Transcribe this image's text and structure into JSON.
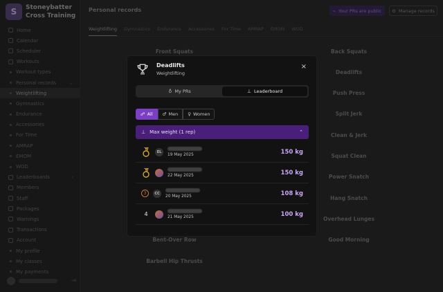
{
  "app": {
    "brand_name": "Stoneybatter Cross Training",
    "brand_initial": "S"
  },
  "sidebar": {
    "items": [
      {
        "label": "Home",
        "type": "item"
      },
      {
        "label": "Calendar",
        "type": "item"
      },
      {
        "label": "Scheduler",
        "type": "item"
      },
      {
        "label": "Workouts",
        "type": "item"
      },
      {
        "label": "Workout types",
        "type": "sub"
      },
      {
        "label": "Personal records",
        "type": "sub"
      },
      {
        "label": "Weightlifting",
        "type": "sub",
        "active": true
      },
      {
        "label": "Gymnastics",
        "type": "sub"
      },
      {
        "label": "Endurance",
        "type": "sub"
      },
      {
        "label": "Accessories",
        "type": "sub"
      },
      {
        "label": "For Time",
        "type": "sub"
      },
      {
        "label": "AMRAP",
        "type": "sub"
      },
      {
        "label": "EMOM",
        "type": "sub"
      },
      {
        "label": "WOD",
        "type": "sub"
      },
      {
        "label": "Leaderboards",
        "type": "item"
      },
      {
        "label": "Members",
        "type": "item"
      },
      {
        "label": "Staff",
        "type": "item"
      },
      {
        "label": "Packages",
        "type": "item"
      },
      {
        "label": "Warnings",
        "type": "item"
      },
      {
        "label": "Transactions",
        "type": "item"
      },
      {
        "label": "Account",
        "type": "item"
      },
      {
        "label": "My profile",
        "type": "sub"
      },
      {
        "label": "My classes",
        "type": "sub"
      },
      {
        "label": "My payments",
        "type": "sub"
      }
    ]
  },
  "header": {
    "title": "Personal records",
    "public_label": "Your PRs are public",
    "manage_label": "Manage records"
  },
  "tabs": [
    "Weightlifting",
    "Gymnastics",
    "Endurance",
    "Accessories",
    "For Time",
    "AMRAP",
    "EMOM",
    "WOD"
  ],
  "records": {
    "left": [
      "Front Squats",
      "",
      "",
      "",
      "",
      "",
      "",
      "",
      "",
      "Bent-Over Row",
      "Barbell Hip Thrusts"
    ],
    "right": [
      "Back Squats",
      "Deadlifts",
      "Push Press",
      "Split Jerk",
      "Clean & Jerk",
      "Squat Clean",
      "Power Snatch",
      "Hang Snatch",
      "Overhead Lunges",
      "Good Morning"
    ]
  },
  "modal": {
    "title": "Deadlifts",
    "subtitle": "Weightlifting",
    "close": "×",
    "seg_my_prs": "My PRs",
    "seg_leaderboard": "Leaderboard",
    "filter_all": "All",
    "filter_men": "Men",
    "filter_women": "Women",
    "section_title": "Max weight (1 rep)",
    "entries": [
      {
        "rank": "1",
        "initials": "EL",
        "date": "19 May 2025",
        "value": "150 kg",
        "medal": "gold"
      },
      {
        "rank": "1",
        "initials": "",
        "date": "22 May 2025",
        "value": "150 kg",
        "medal": "gold"
      },
      {
        "rank": "3",
        "initials": "CC",
        "date": "20 May 2025",
        "value": "108 kg",
        "medal": "bronze"
      },
      {
        "rank": "4",
        "initials": "",
        "date": "21 May 2025",
        "value": "100 kg",
        "medal": "none"
      }
    ]
  },
  "colors": {
    "accent": "#7a3fc4",
    "accent_dark": "#4a1f7a",
    "value_text": "#c9a6f3",
    "gold": "#d4a62a",
    "bronze": "#c2783a"
  }
}
